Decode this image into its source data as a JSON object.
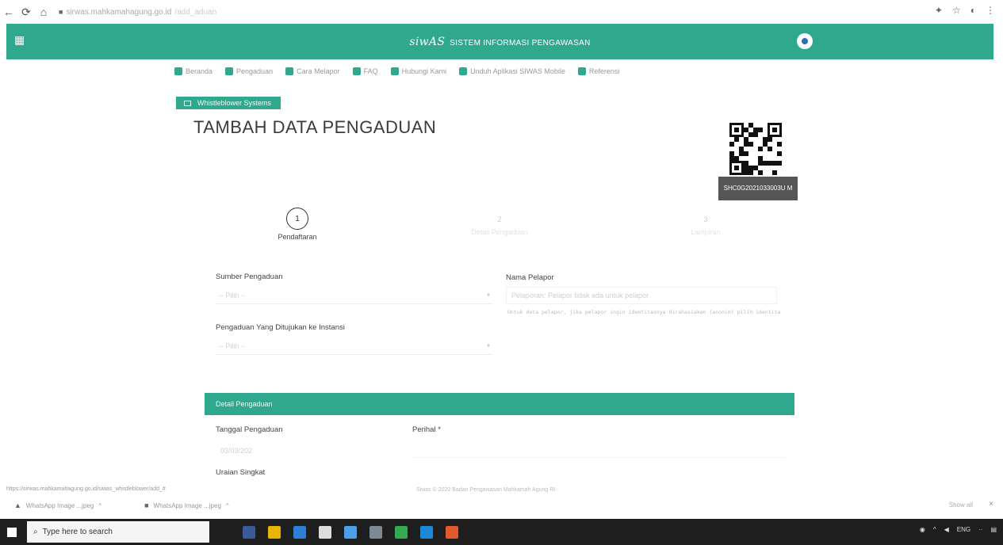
{
  "browser": {
    "url": "sirwas.mahkamahagung.go.id",
    "url_suffix": "/add_aduan"
  },
  "header": {
    "logo_text": "siwAS",
    "app_name": "SISTEM INFORMASI PENGAWASAN"
  },
  "top_menu": [
    {
      "label": "Beranda",
      "icon": "home-icon"
    },
    {
      "label": "Pengaduan",
      "icon": "users-icon"
    },
    {
      "label": "Cara Melapor",
      "icon": "bulb-icon"
    },
    {
      "label": "FAQ",
      "icon": "question-icon"
    },
    {
      "label": "Hubungi Kami",
      "icon": "contact-icon"
    },
    {
      "label": "Unduh Aplikasi SIWAS Mobile",
      "icon": "android-icon"
    },
    {
      "label": "Referensi",
      "icon": "book-icon"
    }
  ],
  "section_badge": "Whistleblower Systems",
  "page": {
    "title": "TAMBAH DATA PENGADUAN"
  },
  "qr": {
    "code": "SHC0G2021033003U M"
  },
  "steps": [
    {
      "number": "1",
      "label": "Pendaftaran",
      "active": true
    },
    {
      "number": "2",
      "label": "Detail Pengaduan",
      "active": false
    },
    {
      "number": "3",
      "label": "Lampiran",
      "active": false
    }
  ],
  "form": {
    "sumber_label": "Sumber Pengaduan",
    "sumber_value": "-- Pilih --",
    "ditujukan_label": "Pengaduan Yang Ditujukan ke Instansi",
    "ditujukan_value": "-- Pilih --",
    "nama_label": "Nama Pelapor",
    "nama_placeholder": "Pelaporan: Pelapor tidak ada untuk pelapor",
    "nama_hint": "Untuk data pelapor, jika pelapor ingin identitasnya dirahasiakan (anonim) pilih identitas pelapor"
  },
  "detail": {
    "section_title": "Detail Pengaduan",
    "tanggal_label": "Tanggal Pengaduan",
    "tanggal_value": "03/03/202",
    "perihal_label": "Perihal *",
    "uraian_label": "Uraian Singkat"
  },
  "status_url": "https://sirwas.mahkamahagung.go.id/siwas_whistleblower/add_#",
  "footer": "Siwas © 2020 Badan Pengawasan Mahkamah Agung RI",
  "downloads": [
    {
      "name": "WhatsApp Image ...jpeg"
    },
    {
      "name": "WhatsApp Image ...jpeg"
    }
  ],
  "downloads_show_all": "Show all",
  "taskbar": {
    "search_placeholder": "Type here to search"
  }
}
